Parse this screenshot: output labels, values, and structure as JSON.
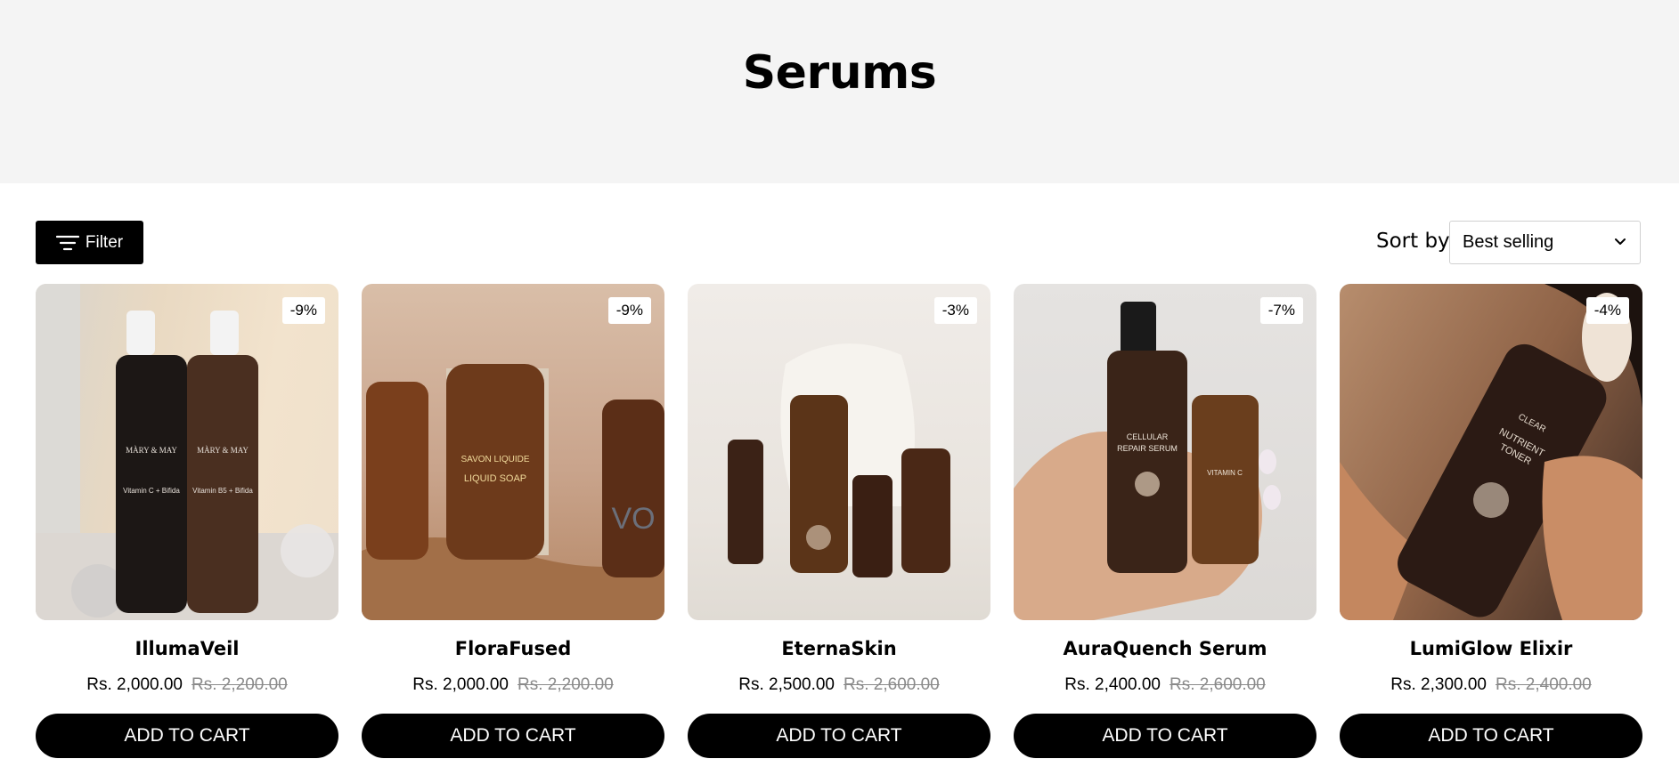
{
  "page": {
    "title": "Serums"
  },
  "toolbar": {
    "filter_label": "Filter",
    "sort_label": "Sort by",
    "sort_value": "Best selling"
  },
  "products": [
    {
      "name": "IllumaVeil",
      "price": "Rs. 2,000.00",
      "compare_price": "Rs. 2,200.00",
      "discount": "-9%",
      "cta": "ADD TO CART",
      "bottle_text_1": "MÀRY & MAY",
      "bottle_text_2": "Vitamin C + Bifida",
      "bottle_text_3": "Vitamin B5 + Bifida"
    },
    {
      "name": "FloraFused",
      "price": "Rs. 2,000.00",
      "compare_price": "Rs. 2,200.00",
      "discount": "-9%",
      "cta": "ADD TO CART",
      "bottle_text_1": "SAVON LIQUIDE",
      "bottle_text_2": "LIQUID SOAP",
      "bottle_text_3": "VO"
    },
    {
      "name": "EternaSkin",
      "price": "Rs. 2,500.00",
      "compare_price": "Rs. 2,600.00",
      "discount": "-3%",
      "cta": "ADD TO CART"
    },
    {
      "name": "AuraQuench Serum",
      "price": "Rs. 2,400.00",
      "compare_price": "Rs. 2,600.00",
      "discount": "-7%",
      "cta": "ADD TO CART",
      "bottle_text_1": "CELLULAR",
      "bottle_text_2": "REPAIR SERUM",
      "bottle_text_3": "VITAMIN C"
    },
    {
      "name": "LumiGlow Elixir",
      "price": "Rs. 2,300.00",
      "compare_price": "Rs. 2,400.00",
      "discount": "-4%",
      "cta": "ADD TO CART",
      "bottle_text_1": "CLEAR",
      "bottle_text_2": "NUTRIENT",
      "bottle_text_3": "TONER"
    }
  ],
  "icons": {
    "filter": "filter-icon",
    "sort": "chevron-down-icon"
  }
}
